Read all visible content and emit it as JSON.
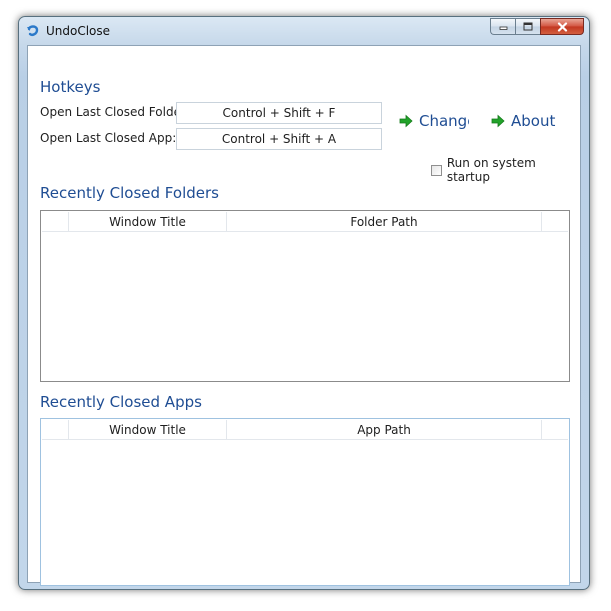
{
  "window": {
    "title": "UndoClose"
  },
  "hotkeys": {
    "heading": "Hotkeys",
    "folder_label": "Open Last Closed Folder:",
    "folder_value": "Control + Shift + F",
    "app_label": "Open Last Closed App:",
    "app_value": "Control + Shift + A",
    "change_label": "Change",
    "about_label": "About",
    "startup_label": "Run on system startup",
    "startup_checked": false
  },
  "folders": {
    "heading": "Recently Closed Folders",
    "columns": [
      "Window Title",
      "Folder Path"
    ],
    "rows": []
  },
  "apps": {
    "heading": "Recently Closed Apps",
    "columns": [
      "Window Title",
      "App Path"
    ],
    "rows": []
  },
  "colors": {
    "accent": "#1f4d93",
    "arrow": "#22a32a",
    "close": "#c23620"
  },
  "icons": {
    "app": "undo-arrow-icon",
    "link": "green-arrow-icon"
  }
}
